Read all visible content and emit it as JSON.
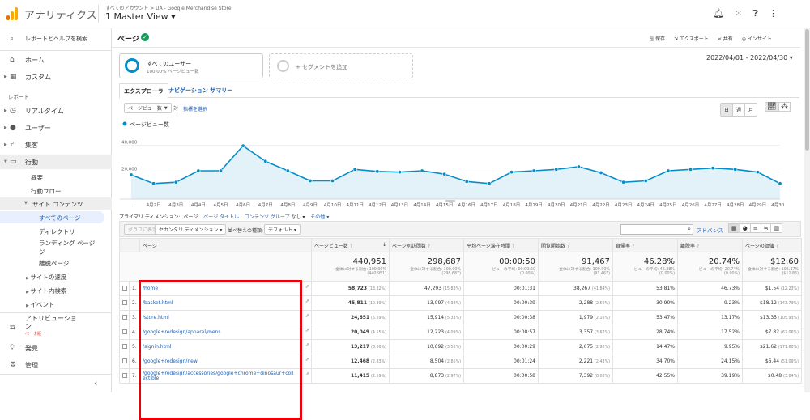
{
  "app": {
    "title": "アナリティクス",
    "breadcrumb": "すべてのアカウント > UA - Google Merchandise Store",
    "view": "1 Master View ▾"
  },
  "sidebar": {
    "search": "レポートとヘルプを検索",
    "home": "ホーム",
    "custom": "カスタム",
    "reports_heading": "レポート",
    "realtime": "リアルタイム",
    "audience": "ユーザー",
    "acquisition": "集客",
    "behavior": "行動",
    "overview": "概要",
    "flow": "行動フロー",
    "site_content": "サイト コンテンツ",
    "all_pages": "すべてのページ",
    "directory": "ディレクトリ",
    "landing1": "ランディング ページ",
    "landing2": "ジ",
    "exit": "離脱ページ",
    "speed": "サイトの速度",
    "search_site": "サイト内検索",
    "events": "イベント",
    "attribution1": "アトリビューショ",
    "attribution2": "ン",
    "beta": "ベータ版",
    "discover": "発見",
    "admin": "管理"
  },
  "header": {
    "title": "ページ",
    "save": "保存",
    "export": "エクスポート",
    "share": "共有",
    "insight": "インサイト"
  },
  "segment": {
    "all_users": "すべてのユーザー",
    "all_users_sub": "100.00% ページビュー数",
    "add": "+ セグメントを追加"
  },
  "daterange": "2022/04/01 - 2022/04/30 ▾",
  "tabs": {
    "explorer": "エクスプローラ",
    "nav": "ナビゲーション サマリー"
  },
  "chart_controls": {
    "metric": "ページビュー数",
    "vs": "対",
    "select": "指標を選択",
    "day": "日",
    "week": "週",
    "month": "月"
  },
  "chart_data": {
    "type": "area",
    "legend": "ページビュー数",
    "ylabels": [
      "40,000",
      "20,000"
    ],
    "ylim": [
      0,
      48000
    ],
    "x": [
      "4月1日",
      "4月2日",
      "4月3日",
      "4月4日",
      "4月5日",
      "4月6日",
      "4月7日",
      "4月8日",
      "4月9日",
      "4月10日",
      "4月11日",
      "4月12日",
      "4月13日",
      "4月14日",
      "4月15日",
      "4月16日",
      "4月17日",
      "4月18日",
      "4月19日",
      "4月20日",
      "4月21日",
      "4月22日",
      "4月23日",
      "4月24日",
      "4月25日",
      "4月26日",
      "4月27日",
      "4月28日",
      "4月29日",
      "4月30日"
    ],
    "xlabels": [
      "...",
      "4月2日",
      "4月3日",
      "4月4日",
      "4月5日",
      "4月6日",
      "4月7日",
      "4月8日",
      "4月9日",
      "4月10日",
      "4月11日",
      "4月12日",
      "4月13日",
      "4月14日",
      "4月15日",
      "4月16日",
      "4月17日",
      "4月18日",
      "4月19日",
      "4月20日",
      "4月21日",
      "4月22日",
      "4月23日",
      "4月24日",
      "4月25日",
      "4月26日",
      "4月27日",
      "4月28日",
      "4月29日",
      "4月30日"
    ],
    "values": [
      18000,
      11500,
      12500,
      21000,
      21000,
      39500,
      28000,
      21000,
      13500,
      13500,
      22000,
      20500,
      20000,
      21000,
      18500,
      13000,
      11500,
      20000,
      21000,
      22000,
      24000,
      19500,
      12500,
      13500,
      21000,
      22000,
      23000,
      22000,
      20000,
      11500
    ],
    "color": "#058dc7"
  },
  "dimension_bar": {
    "primary": "プライマリ ディメンション:",
    "page": "ページ",
    "title": "ページ タイトル",
    "group": "コンテンツ グループ",
    "none": "なし ▾",
    "other": "その他 ▾"
  },
  "toolbar": {
    "graph": "グラフに表示",
    "secondary": "セカンダリ ディメンション ▾",
    "sort": "並べ替えの種類:",
    "default": "デフォルト ▾",
    "advanced": "アドバンス"
  },
  "table": {
    "headers": [
      "ページ",
      "ページビュー数",
      "ページ別訪問数",
      "平均ページ滞在時間",
      "閲覧開始数",
      "直帰率",
      "離脱率",
      "ページの価値"
    ],
    "totals": [
      {
        "value": "440,951",
        "sub1": "全体に対する割合: 100.00%",
        "sub2": "(440,951)"
      },
      {
        "value": "298,687",
        "sub1": "全体に対する割合: 100.00%",
        "sub2": "(298,687)"
      },
      {
        "value": "00:00:50",
        "sub1": "ビューの平均: 00:00:50",
        "sub2": "(0.00%)"
      },
      {
        "value": "91,467",
        "sub1": "全体に対する割合: 100.00%",
        "sub2": "(91,467)"
      },
      {
        "value": "46.28%",
        "sub1": "ビューの平均: 46.28%",
        "sub2": "(0.00%)"
      },
      {
        "value": "20.74%",
        "sub1": "ビューの平均: 20.74%",
        "sub2": "(0.00%)"
      },
      {
        "value": "$12.60",
        "sub1": "全体に対する割合: 106.37%",
        "sub2": "($11.85)"
      }
    ],
    "rows": [
      {
        "n": "1.",
        "page": "/home",
        "pv": "58,723",
        "pvp": "(13.32%)",
        "up": "47,293",
        "upp": "(15.83%)",
        "time": "00:01:31",
        "ent": "38,267",
        "entp": "(41.84%)",
        "br": "53.81%",
        "ex": "46.73%",
        "val": "$1.54",
        "valp": "(12.23%)"
      },
      {
        "n": "2.",
        "page": "/basket.html",
        "pv": "45,811",
        "pvp": "(10.39%)",
        "up": "13,097",
        "upp": "(4.38%)",
        "time": "00:00:39",
        "ent": "2,288",
        "entp": "(2.50%)",
        "br": "30.90%",
        "ex": "9.23%",
        "val": "$18.12",
        "valp": "(143.79%)"
      },
      {
        "n": "3.",
        "page": "/store.html",
        "pv": "24,651",
        "pvp": "(5.59%)",
        "up": "15,914",
        "upp": "(5.33%)",
        "time": "00:00:38",
        "ent": "1,979",
        "entp": "(2.16%)",
        "br": "53.47%",
        "ex": "13.17%",
        "val": "$13.35",
        "valp": "(105.93%)"
      },
      {
        "n": "4.",
        "page": "/google+redesign/apparel/mens",
        "pv": "20,049",
        "pvp": "(4.55%)",
        "up": "12,223",
        "upp": "(4.09%)",
        "time": "00:00:57",
        "ent": "3,357",
        "entp": "(3.67%)",
        "br": "28.74%",
        "ex": "17.52%",
        "val": "$7.82",
        "valp": "(62.06%)"
      },
      {
        "n": "5.",
        "page": "/signin.html",
        "pv": "13,217",
        "pvp": "(3.00%)",
        "up": "10,692",
        "upp": "(3.58%)",
        "time": "00:00:29",
        "ent": "2,675",
        "entp": "(2.92%)",
        "br": "14.47%",
        "ex": "9.95%",
        "val": "$21.62",
        "valp": "(171.60%)"
      },
      {
        "n": "6.",
        "page": "/google+redesign/new",
        "pv": "12,468",
        "pvp": "(2.83%)",
        "up": "8,504",
        "upp": "(2.85%)",
        "time": "00:01:24",
        "ent": "2,221",
        "entp": "(2.43%)",
        "br": "34.70%",
        "ex": "24.15%",
        "val": "$6.44",
        "valp": "(51.09%)"
      },
      {
        "n": "7.",
        "page": "/google+redesign/accessories/google+chrome+dinosaur+coll",
        "page2": "ectible",
        "pv": "11,415",
        "pvp": "(2.59%)",
        "up": "8,873",
        "upp": "(2.97%)",
        "time": "00:00:58",
        "ent": "7,392",
        "entp": "(8.08%)",
        "br": "42.55%",
        "ex": "39.19%",
        "val": "$0.48",
        "valp": "(3.84%)"
      }
    ]
  },
  "colors": {
    "accent": "#058dc7",
    "highlight": "#e8f0fe",
    "annotation": "#e8000b",
    "link": "#1a5fb4"
  }
}
